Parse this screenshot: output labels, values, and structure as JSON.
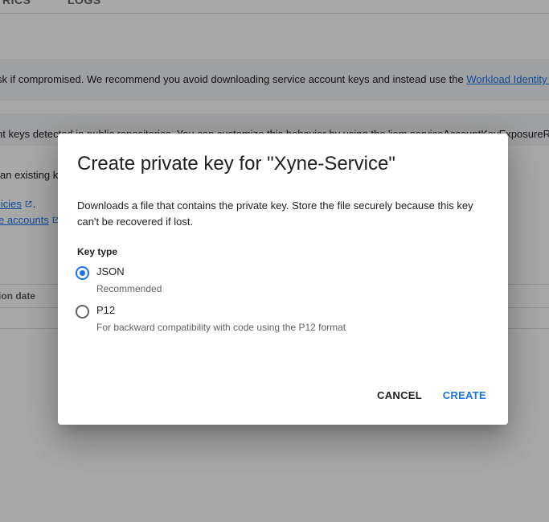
{
  "background": {
    "tabs": [
      "TRICS",
      "LOGS"
    ],
    "banner1": {
      "text": "sk if compromised. We recommend you avoid downloading service account keys and instead use the ",
      "link": "Workload Identity F"
    },
    "banner2": {
      "text": "nt keys detected in public repositories. You can customize this behavior by using the 'iam.serviceAccountKeyExposureR"
    },
    "line1": "an existing k",
    "line2_link": "licies",
    "line2_suffix": ".",
    "line3_link": "e accounts",
    "table_header": "tion date"
  },
  "dialog": {
    "title": "Create private key for \"Xyne-Service\"",
    "description": "Downloads a file that contains the private key. Store the file securely because this key can't be recovered if lost.",
    "key_type_label": "Key type",
    "options": [
      {
        "label": "JSON",
        "hint": "Recommended",
        "selected": true
      },
      {
        "label": "P12",
        "hint": "For backward compatibility with code using the P12 format",
        "selected": false
      }
    ],
    "cancel_label": "CANCEL",
    "create_label": "CREATE"
  },
  "colors": {
    "accent": "#1a73e8",
    "scrim": "rgba(0,0,0,0.34)",
    "banner_bg": "#f1f3f4"
  },
  "icons": {
    "external_link": "external-link-icon",
    "radio_selected": "radio-checked-icon",
    "radio_unselected": "radio-unchecked-icon"
  }
}
